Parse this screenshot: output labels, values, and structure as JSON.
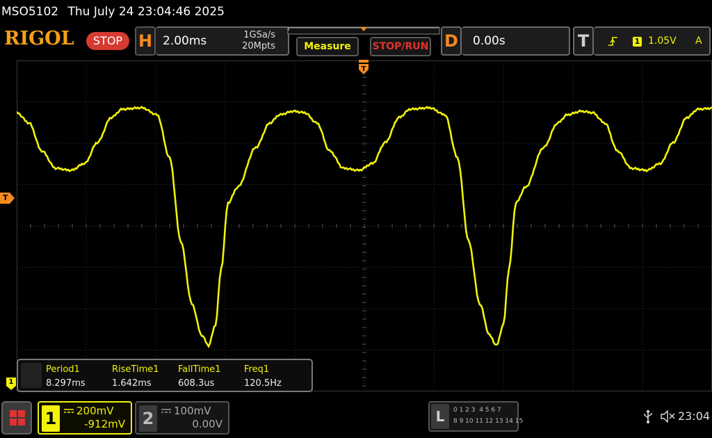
{
  "titlebar": {
    "model": "MSO5102",
    "datetime": "Thu July 24 23:04:46 2025"
  },
  "header": {
    "logo": "RIGOL",
    "run_state": "STOP",
    "horizontal": {
      "letter": "H",
      "timebase": "2.00ms",
      "sample_rate": "1GSa/s",
      "memory_depth": "20Mpts"
    },
    "measure_label": "Measure",
    "stop_run_label": "STOP/RUN",
    "delay": {
      "letter": "D",
      "value": "0.00s"
    },
    "trigger": {
      "letter": "T",
      "channel": "1",
      "level": "1.05V",
      "mode": "A"
    }
  },
  "screen": {
    "trigger_marker": "T",
    "channel_marker": "1",
    "measurements": [
      {
        "label": "Period1",
        "value": "8.297ms"
      },
      {
        "label": "RiseTime1",
        "value": "1.642ms"
      },
      {
        "label": "FallTime1",
        "value": "608.3us"
      },
      {
        "label": "Freq1",
        "value": "120.5Hz"
      }
    ]
  },
  "channels": [
    {
      "number": "1",
      "scale": "200mV",
      "offset": "-912mV",
      "active": true
    },
    {
      "number": "2",
      "scale": "100mV",
      "offset": "0.00V",
      "active": false
    }
  ],
  "logic": {
    "letter": "L",
    "row1": "0 1 2 3  4 5 6 7",
    "row2": "8 9 10 11 12 13 14 15"
  },
  "status": {
    "time": "23:04"
  },
  "colors": {
    "trace": "#f2f20a",
    "accent": "#f58a1f",
    "stop": "#d63a30",
    "grid": "#3c3c3c"
  }
}
